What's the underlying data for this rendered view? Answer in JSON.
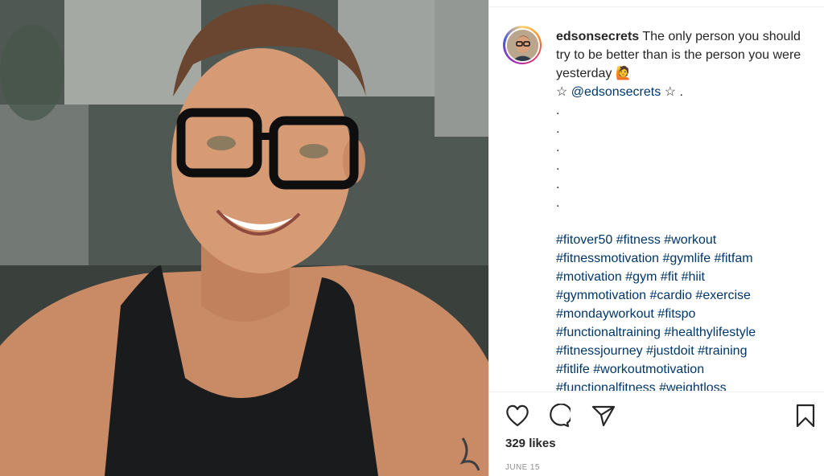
{
  "post": {
    "image_alt": "",
    "author": {
      "username": "edsonsecrets"
    },
    "caption": {
      "text_line1": " The only person you should try to be better than is the person you were yesterday 🙋",
      "mention_prefix": "☆ ",
      "mention": "@edsonsecrets",
      "mention_suffix": " ☆ .",
      "dots": [
        ".",
        ".",
        ".",
        ".",
        ".",
        "."
      ],
      "hashtags": [
        "#fitover50 #fitness #workout",
        "#fitnessmotivation #gymlife #fitfam",
        "#motivation #gym #fit #hiit",
        "#gymmotivation #cardio #exercise",
        "#mondayworkout #fitspo",
        "#functionaltraining #healthylifestyle",
        "#fitnessjourney #justdoit #training",
        "#fitlife #workoutmotivation",
        "#functionalfitness #weightloss"
      ]
    },
    "actions": {
      "like_icon": "heart-icon",
      "comment_icon": "comment-icon",
      "share_icon": "paper-plane-icon",
      "save_icon": "bookmark-icon"
    },
    "likes_label": "329 likes",
    "date_label": "JUNE 15"
  }
}
